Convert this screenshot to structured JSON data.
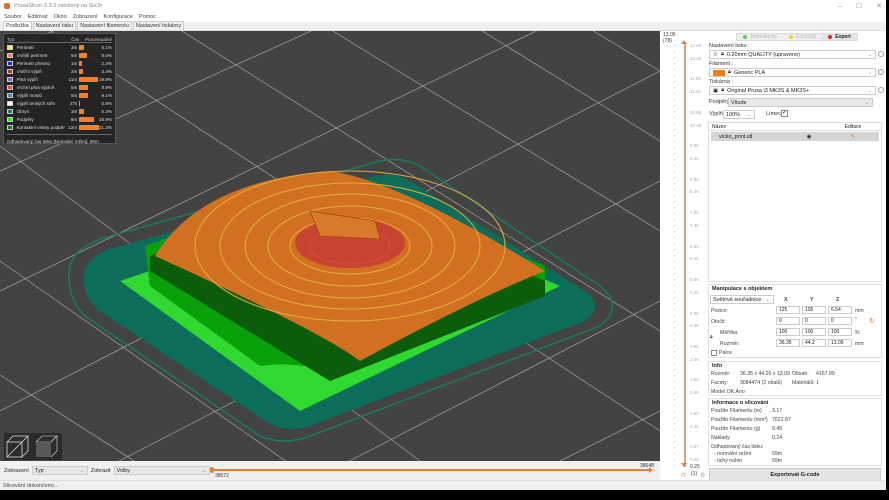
{
  "window": {
    "title": "PrusaSlicer-2.3.3 založený na Slic3r",
    "controls": {
      "minimize": "–",
      "maximize": "☐",
      "close": "✕"
    }
  },
  "menu": [
    "Soubor",
    "Editovat",
    "Okno",
    "Zobrazení",
    "Konfigurace",
    "Pomoc"
  ],
  "tabs": [
    {
      "label": "Podložka",
      "active": true
    },
    {
      "label": "Nastavení tisku",
      "active": false
    },
    {
      "label": "Nastavení filamentu",
      "active": false
    },
    {
      "label": "Nastavení tiskárny",
      "active": false
    }
  ],
  "legend": {
    "headers": {
      "type": "Typ",
      "time": "Čas",
      "percent": "Procentuálně"
    },
    "rows": [
      {
        "name": "Perimetr",
        "time": "3m",
        "percent": "5.1%",
        "fraction": 0.051,
        "color": "#ffe64d"
      },
      {
        "name": "Vnější perimetr",
        "time": "5m",
        "percent": "8.6%",
        "fraction": 0.086,
        "color": "#ff7d38"
      },
      {
        "name": "Perimetr převisu",
        "time": "1m",
        "percent": "2.3%",
        "fraction": 0.023,
        "color": "#1f1fff"
      },
      {
        "name": "Vnitřní výplň",
        "time": "2m",
        "percent": "3.4%",
        "fraction": 0.034,
        "color": "#b03029"
      },
      {
        "name": "Plná výplň",
        "time": "11m",
        "percent": "19.8%",
        "fraction": 0.198,
        "color": "#9654cc"
      },
      {
        "name": "Vrchní plná výplně",
        "time": "5m",
        "percent": "8.9%",
        "fraction": 0.089,
        "color": "#f04040"
      },
      {
        "name": "Výplň mostů",
        "time": "5m",
        "percent": "9.1%",
        "fraction": 0.091,
        "color": "#4d80ba"
      },
      {
        "name": "Výplň tenkých stěn",
        "time": "27s",
        "percent": "0.8%",
        "fraction": 0.008,
        "color": "#ffffff"
      },
      {
        "name": "Obrys",
        "time": "3m",
        "percent": "5.2%",
        "fraction": 0.052,
        "color": "#00876e"
      },
      {
        "name": "Podpěry",
        "time": "9m",
        "percent": "15.9%",
        "fraction": 0.159,
        "color": "#00ff00"
      },
      {
        "name": "Kontaktní vrstvy podpěr",
        "time": "12m",
        "percent": "21.2%",
        "fraction": 0.212,
        "color": "#008000"
      }
    ],
    "footer": "Odhadovaný čas tisku [Normální režim]:  59m"
  },
  "bottom": {
    "view_label": "Zobrazení",
    "view_value": "Typ",
    "show_label": "Zobrazit",
    "show_value": "Volby",
    "hslider_left": "38572",
    "hslider_right": "38648"
  },
  "status": "Slicování dokončeno...",
  "vslider": {
    "top_value": "13.05",
    "top_layer": "(78)",
    "bottom_value": "0.25",
    "bottom_layer": "(1)",
    "ticks": [
      "12.85",
      "12.45",
      "11.85",
      "11.45",
      "10.85",
      "10.45",
      "9.85",
      "9.45",
      "8.85",
      "8.45",
      "7.85",
      "7.45",
      "6.85",
      "6.45",
      "5.85",
      "5.45",
      "4.85",
      "4.45",
      "3.85",
      "3.45",
      "2.85",
      "2.45",
      "1.90",
      "1.45",
      "0.97",
      "0.49"
    ]
  },
  "sidebar": {
    "modes": [
      {
        "label": "Jednoduchý",
        "color": "#5cc75c"
      },
      {
        "label": "Pokročilý",
        "color": "#f2d02a"
      },
      {
        "label": "Expert",
        "color": "#d9262b"
      }
    ],
    "print_settings_label": "Nastavení tisku :",
    "print_settings_value": "0.20mm QUALITY (upraveno)",
    "filament_label": "Filament :",
    "filament_value": "Generic PLA",
    "filament_color": "#f08010",
    "printer_label": "Tiskárna :",
    "printer_value": "Original Prusa i3 MK3S & MK3S+",
    "supports_label": "Podpěry:",
    "supports_value": "Všude",
    "infill_label": "Výplň:",
    "infill_value": "100%",
    "brim_label": "Límec:",
    "brim_checked": true,
    "objlist": {
      "col_name": "Název",
      "col_edit": "Editace",
      "objects": [
        {
          "name": "vicko_print.stl"
        }
      ]
    },
    "manip": {
      "title": "Manipulace s objektem",
      "coord_system": "Světové souřadnice",
      "axes": [
        "X",
        "Y",
        "Z"
      ],
      "position_label": "Pozice:",
      "position": [
        "125",
        "105",
        "6.54"
      ],
      "position_unit": "mm",
      "rotation_label": "Otočit:",
      "rotation": [
        "0",
        "0",
        "0"
      ],
      "rotation_unit": "°",
      "scale_label": "Měřítka:",
      "scale": [
        "100",
        "100",
        "100"
      ],
      "scale_unit": "%",
      "size_label": "Rozměr:",
      "size": [
        "36.35",
        "44.2",
        "13.09"
      ],
      "size_unit": "mm",
      "inches_label": "Palce"
    },
    "info": {
      "title": "Info",
      "size_label": "Rozměr:",
      "size_value": "36.35 x 44.20 x 13.09",
      "volume_label": "Obsah:",
      "volume_value": "4167.89",
      "facets_label": "Facety:",
      "facets_value": "3084474 (2 obalů)",
      "materials_label": "Materiálů:",
      "materials_value": "1",
      "model_ok": "Model OK:Ano"
    },
    "slicing": {
      "title": "Informace o slicování",
      "rows": [
        {
          "label": "Použito Filamentu (m)",
          "value": "3.17"
        },
        {
          "label": "Použito Filamentu (mm³)",
          "value": "7621.87"
        },
        {
          "label": "Použito Filamentu (g)",
          "value": "9.45"
        },
        {
          "label": "Náklady",
          "value": "0.24"
        }
      ],
      "est_time_label": "Odhadovaný čas tisku:",
      "normal_label": "- normální režim",
      "normal_value": "59m",
      "silent_label": "- tichý režim",
      "silent_value": "59m"
    },
    "export_label": "Exportovat G-code"
  }
}
